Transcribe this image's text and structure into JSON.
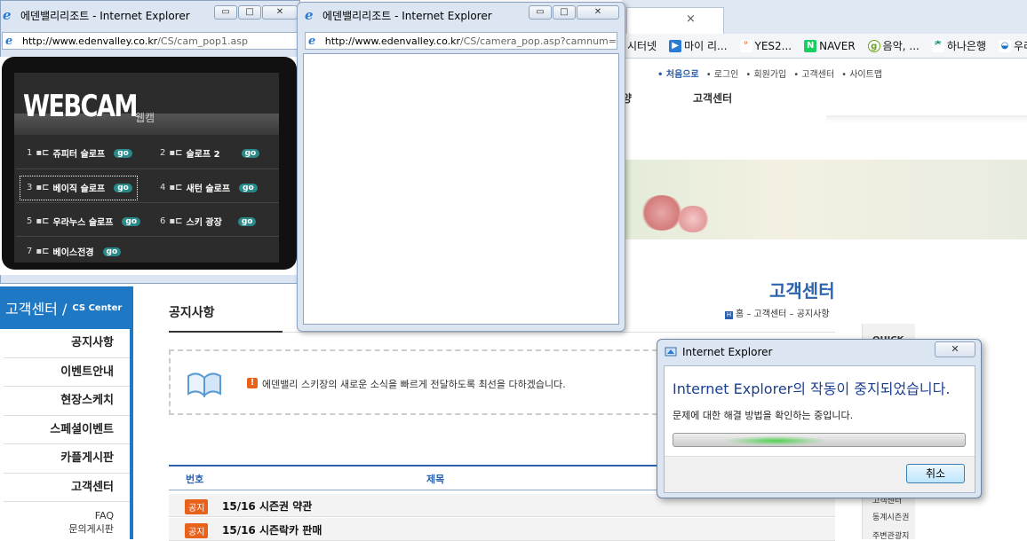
{
  "background_browser": {
    "tab_close": "×",
    "favorites": [
      {
        "label": "시터넷",
        "icon": "page-icon",
        "color": "#ffffff"
      },
      {
        "label": "마이 리...",
        "icon": "play-icon",
        "color": "#2a7bd6"
      },
      {
        "label": "YES2...",
        "icon": "smile-icon",
        "color": "#e05a1e"
      },
      {
        "label": "NAVER",
        "icon": "naver-icon",
        "color": "#19ce60"
      },
      {
        "label": "음악, ...",
        "icon": "music-icon",
        "color": "#6aa31e"
      },
      {
        "label": "하나은행",
        "icon": "bank-icon",
        "color": "#0a8a7a"
      },
      {
        "label": "우리",
        "icon": "woori-icon",
        "color": "#1a6fc2"
      }
    ],
    "favorite_glyphs": [
      "",
      "▶",
      "ᐡ",
      "N",
      "g",
      "ᅔ",
      "◒"
    ],
    "site": {
      "topnav": [
        "• 처음으로",
        "• 로그인",
        "• 회원가입",
        "• 고객센터",
        "• 사이트맵"
      ],
      "gnb_partial": "양",
      "gnb": "고객센터",
      "cs_title": "고객센터",
      "breadcrumb": "홈 – 고객센터 – 공지사항",
      "breadcrumb_icon": "H",
      "quick_menu": [
        "QUICK",
        "고객센터",
        "동계시즌권",
        "주변관광지"
      ],
      "sidebar": {
        "head_big": "고객센터 /",
        "head_small": "CS Center",
        "items": [
          "공지사항",
          "이벤트안내",
          "현장스케치",
          "스페셜이벤트",
          "카플게시판",
          "고객센터"
        ],
        "sub_items": [
          "FAQ",
          "문의게시판"
        ]
      },
      "page_title": "공지사항",
      "notice_icon": "!",
      "notice_text": "에덴밸리 스키장의 새로운 소식을 빠르게 전달하도록 최선을 다하겠습니다.",
      "table": {
        "col_no": "번호",
        "col_title": "제목",
        "rows": [
          {
            "badge": "공지",
            "title": "15/16 시즌권 약관"
          },
          {
            "badge": "공지",
            "title": "15/16 시즌락카 판매"
          }
        ]
      }
    }
  },
  "window1": {
    "title": "에덴밸리리조트 - Internet Explorer",
    "url_host": "http://www.edenvalley.co.kr",
    "url_path": "/CS/cam_pop1.asp",
    "buttons": {
      "minimize": "▭",
      "maximize": "□",
      "close": "✕"
    },
    "webcam": {
      "logo": "WEBCAM",
      "logo_sub": "웹캠",
      "cameras": [
        {
          "num": "1",
          "name": "쥬피터 슬로프",
          "go": "go"
        },
        {
          "num": "2",
          "name": "슬로프 2",
          "go": "go"
        },
        {
          "num": "3",
          "name": "베이직 슬로프",
          "go": "go"
        },
        {
          "num": "4",
          "name": "새턴 슬로프",
          "go": "go"
        },
        {
          "num": "5",
          "name": "우라누스 슬로프",
          "go": "go"
        },
        {
          "num": "6",
          "name": "스키 광장",
          "go": "go"
        },
        {
          "num": "7",
          "name": "베이스전경",
          "go": "go"
        }
      ],
      "cam_glyph": "▪⊏"
    }
  },
  "window2": {
    "title": "에덴밸리리조트 - Internet Explorer",
    "url_host": "http://www.edenvalley.co.kr",
    "url_path": "/CS/camera_pop.asp?camnum=",
    "buttons": {
      "minimize": "▭",
      "maximize": "□",
      "close": "✕"
    }
  },
  "dialog": {
    "title": "Internet Explorer",
    "heading": "Internet Explorer의 작동이 중지되었습니다.",
    "text": "문제에 대한 해결 방법을 확인하는 중입니다.",
    "cancel": "취소",
    "close": "✕"
  }
}
